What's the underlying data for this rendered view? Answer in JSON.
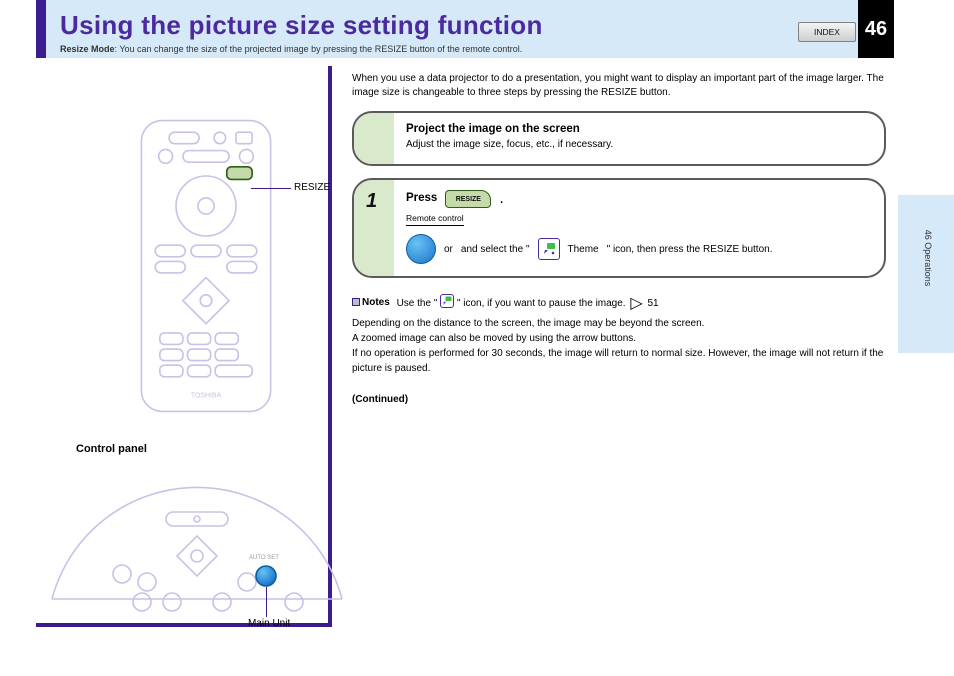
{
  "header": {
    "title": "Using the picture size setting function",
    "subtitle_label": "Resize Mode",
    "subtitle_rest": ": You can change the size of the projected image by pressing the RESIZE button of the remote control.",
    "index_button": "INDEX",
    "page_number": "46"
  },
  "side_label": "46 Operations",
  "left": {
    "remote_callout": "RESIZE",
    "panel_heading": "Control panel",
    "panel_callout": "Main Unit",
    "panel_button_label": "AUTO SET",
    "remote_brand": "TOSHIBA"
  },
  "main": {
    "intro": "When you use a data projector to do a presentation, you might want to display an important part of the image larger. The image size is changeable to three steps by pressing the RESIZE button.",
    "box1": {
      "heading": "Project the image on the screen",
      "text": "Adjust the image size, focus, etc., if necessary."
    },
    "box2": {
      "step": "1",
      "press_word": "Press",
      "button_label": "RESIZE",
      "underline": "Remote control",
      "or_label": "or",
      "after_or": "and select the \"",
      "theme_word": "Theme",
      "after_theme": "\" icon, then press the RESIZE button."
    },
    "notes": {
      "label": "Notes",
      "n1_before": "Use the \"",
      "n1_mid": "\" icon, if you want to pause the image.",
      "n1_arrow_page": "51",
      "n2": "Depending on the distance to the screen, the image may be beyond the screen.",
      "n3": "A zoomed image can also be moved by using the arrow buttons.",
      "n4": "If no operation is performed for 30 seconds, the image will return to normal size. However, the image will not return if the picture is paused."
    },
    "continued": "(Continued)"
  }
}
